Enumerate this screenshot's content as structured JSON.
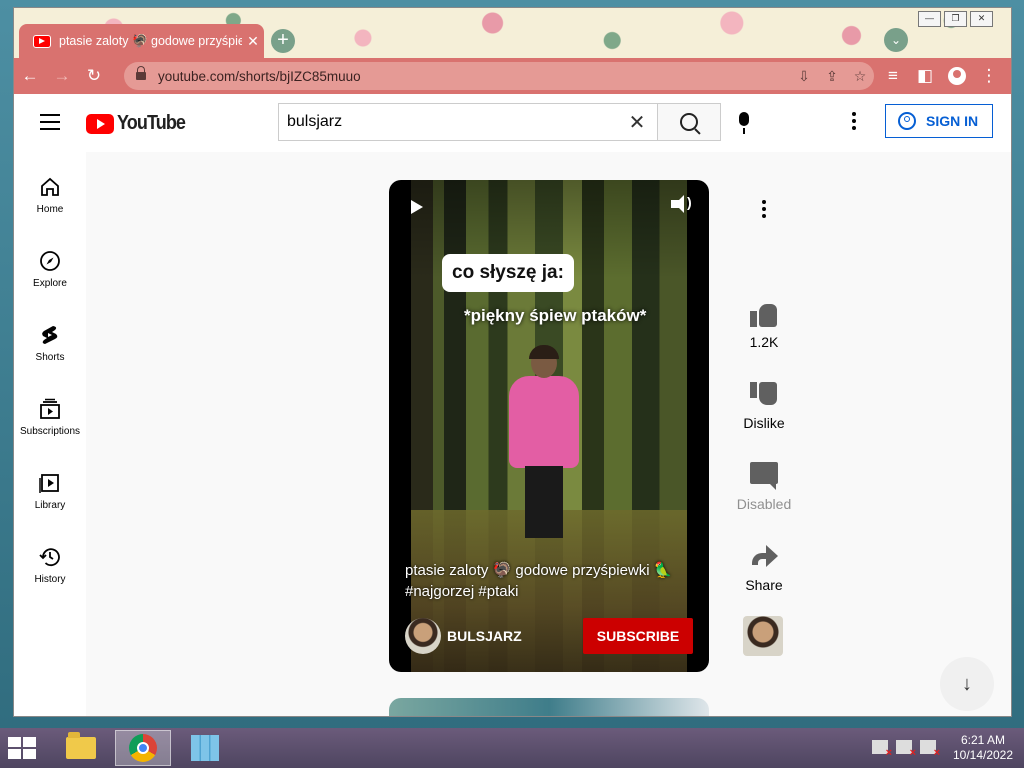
{
  "browser": {
    "tab_title": "ptasie zaloty 🦃 godowe przyśpie",
    "tab_close": "✕",
    "new_tab": "+",
    "url": "youtube.com/shorts/bjIZC85muuo",
    "back": "←",
    "forward": "→",
    "reload": "↻",
    "star": "☆",
    "menu_dots": "⋮"
  },
  "youtube": {
    "logo_text": "YouTube",
    "search_value": "bulsjarz",
    "clear_symbol": "✕",
    "sign_in_label": "SIGN IN"
  },
  "sidebar": {
    "items": [
      {
        "label": "Home",
        "icon": "home-icon"
      },
      {
        "label": "Explore",
        "icon": "compass-icon"
      },
      {
        "label": "Shorts",
        "icon": "shorts-icon"
      },
      {
        "label": "Subscriptions",
        "icon": "subscriptions-icon"
      },
      {
        "label": "Library",
        "icon": "library-icon"
      },
      {
        "label": "History",
        "icon": "history-icon"
      }
    ]
  },
  "short": {
    "overlay_caption": "co słyszę ja:",
    "overlay_subcaption": "*piękny śpiew ptaków*",
    "title": "ptasie zaloty 🦃 godowe przyśpiewki 🦜 #najgorzej #ptaki",
    "channel_name": "BULSJARZ",
    "subscribe_label": "SUBSCRIBE"
  },
  "actions": {
    "like_count": "1.2K",
    "dislike_label": "Dislike",
    "comments_label": "Disabled",
    "share_label": "Share"
  },
  "scroll_down": "↓",
  "taskbar": {
    "time": "6:21 AM",
    "date": "10/14/2022"
  }
}
